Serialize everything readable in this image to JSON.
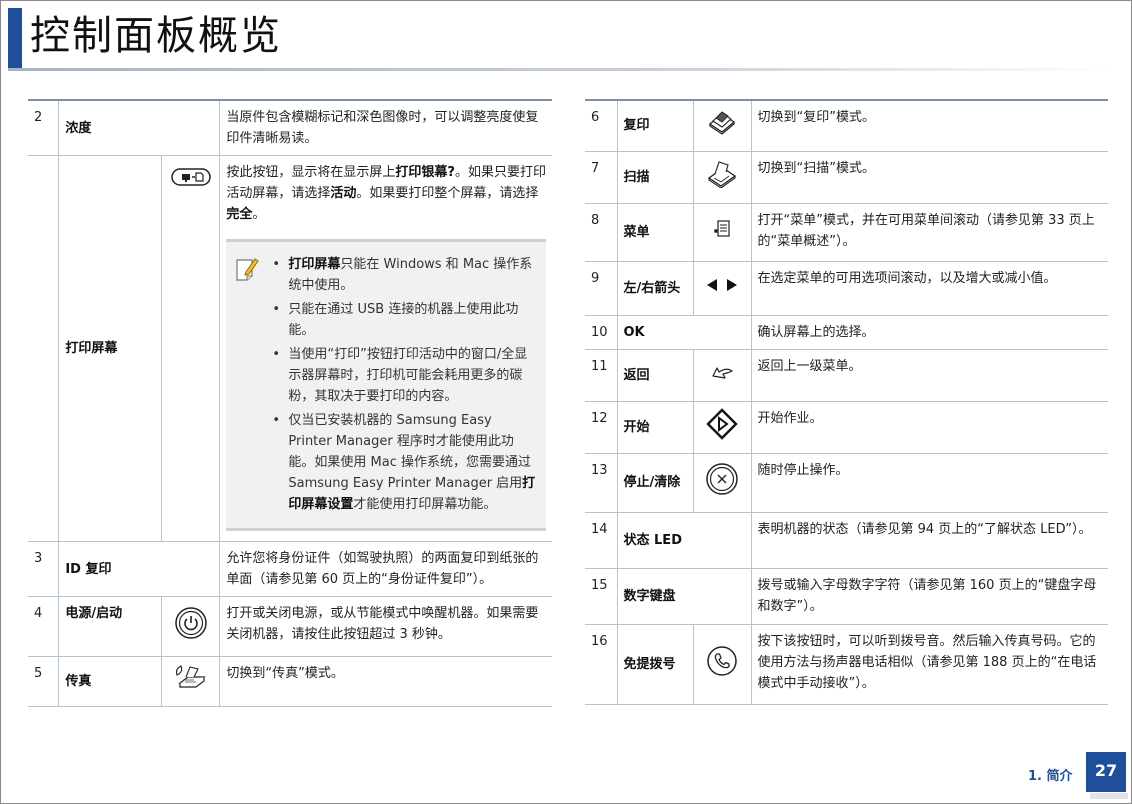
{
  "page": {
    "title": "控制面板概览",
    "footer_label": "1. 简介",
    "page_number": "27",
    "accent_color": "#1f4e9b"
  },
  "left_rows": [
    {
      "num": "2",
      "name": "浓度",
      "desc": "当原件包含模糊标记和深色图像时，可以调整亮度使复印件清晰易读。"
    },
    {
      "name": "打印屏幕",
      "icon": "print-screen-icon",
      "desc_parts": [
        "按此按钮，显示将在显示屏上",
        "打印银幕?",
        "。如果只要打印活动屏幕，请选择",
        "活动",
        "。如果要打印整个屏幕，请选择",
        "完全",
        "。"
      ],
      "note_icon": "note-pencil-icon",
      "notes": [
        {
          "bold": "打印屏幕",
          "text": "只能在 Windows 和 Mac 操作系统中使用。"
        },
        {
          "text": "只能在通过 USB 连接的机器上使用此功能。"
        },
        {
          "text": "当使用“打印”按钮打印活动中的窗口/全显示器屏幕时，打印机可能会耗用更多的碳粉，其取决于要打印的内容。"
        },
        {
          "text": "仅当已安装机器的 Samsung Easy Printer Manager 程序时才能使用此功能。如果使用 Mac 操作系统，您需要通过 Samsung Easy Printer Manager 启用",
          "bold_end": "打印屏幕设置",
          "text_end": "才能使用打印屏幕功能。"
        }
      ]
    },
    {
      "num": "3",
      "name": "ID 复印",
      "desc": "允许您将身份证件（如驾驶执照）的两面复印到纸张的单面（请参见第 60 页上的“身份证件复印”）。"
    },
    {
      "num": "4",
      "name": "电源/启动",
      "icon": "power-icon",
      "desc": "打开或关闭电源，或从节能模式中唤醒机器。如果需要关闭机器，请按住此按钮超过 3 秒钟。"
    },
    {
      "num": "5",
      "name": "传真",
      "icon": "fax-icon",
      "desc": "切换到“传真”模式。"
    }
  ],
  "right_rows": [
    {
      "num": "6",
      "name": "复印",
      "icon": "copy-icon",
      "desc": "切换到“复印”模式。"
    },
    {
      "num": "7",
      "name": "扫描",
      "icon": "scan-icon",
      "desc": "切换到“扫描”模式。"
    },
    {
      "num": "8",
      "name": "菜单",
      "icon": "menu-icon",
      "desc": "打开“菜单”模式，并在可用菜单间滚动（请参见第 33 页上的“菜单概述”）。"
    },
    {
      "num": "9",
      "name": "左/右箭头",
      "icon": "left-right-arrows-icon",
      "desc": "在选定菜单的可用选项间滚动，以及增大或减小值。"
    },
    {
      "num": "10",
      "name": "OK",
      "desc": "确认屏幕上的选择。"
    },
    {
      "num": "11",
      "name": "返回",
      "icon": "back-icon",
      "desc": "返回上一级菜单。"
    },
    {
      "num": "12",
      "name": "开始",
      "icon": "start-icon",
      "desc": "开始作业。"
    },
    {
      "num": "13",
      "name": "停止/清除",
      "icon": "stop-clear-icon",
      "desc": "随时停止操作。"
    },
    {
      "num": "14",
      "name": "状态 LED",
      "desc": "表明机器的状态（请参见第 94 页上的“了解状态 LED”）。"
    },
    {
      "num": "15",
      "name": "数字键盘",
      "desc": "拨号或输入字母数字字符（请参见第 160 页上的“键盘字母和数字”）。"
    },
    {
      "num": "16",
      "name": "免提拨号",
      "icon": "on-hook-dial-icon",
      "desc": "按下该按钮时，可以听到拨号音。然后输入传真号码。它的使用方法与扬声器电话相似（请参见第 188 页上的“在电话模式中手动接收”）。"
    }
  ]
}
